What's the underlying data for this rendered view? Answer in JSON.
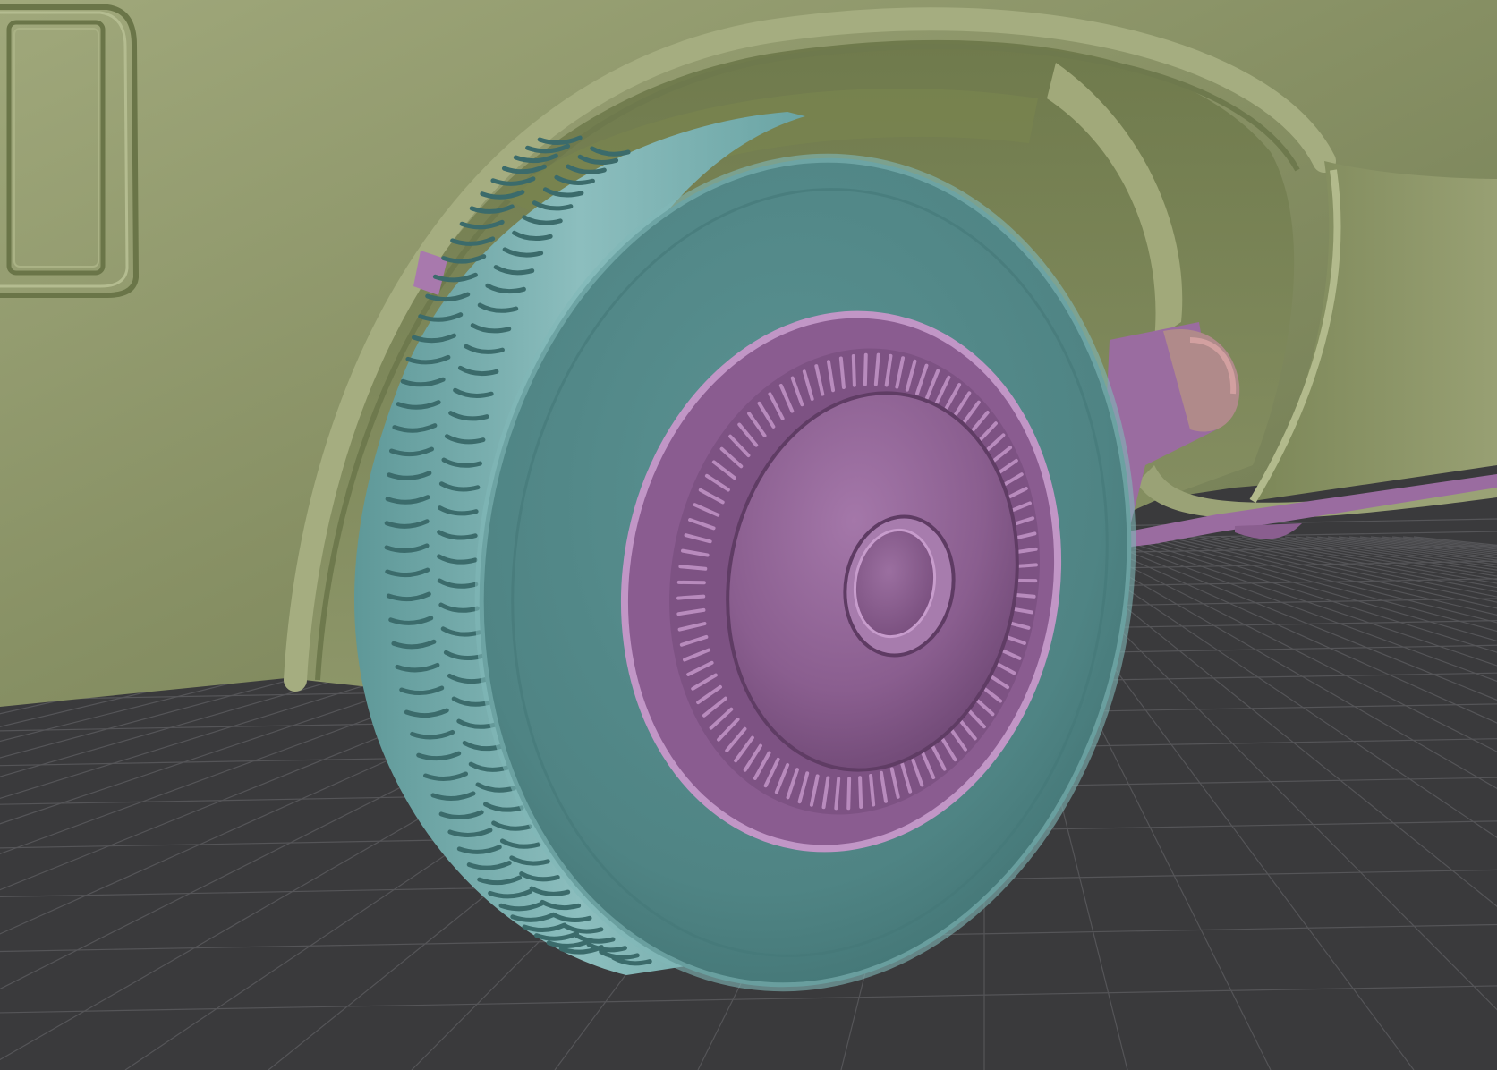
{
  "scene": {
    "subject": "car-rear-wheel-3d-render",
    "colors": {
      "background": "#3a3a3c",
      "grid_line": "#5a5a5c",
      "body_light": "#9ba377",
      "body_mid": "#848d62",
      "body_dark": "#5f6a42",
      "tire_light": "#8ec2c2",
      "tire_mid": "#6aa3a3",
      "tire_dark": "#3f7474",
      "hub_light": "#c08fc6",
      "hub_mid": "#9a6a9f",
      "hub_dark": "#6a4470"
    },
    "materials": [
      "car-body",
      "tire",
      "hubcap",
      "chassis",
      "floor-grid"
    ]
  }
}
